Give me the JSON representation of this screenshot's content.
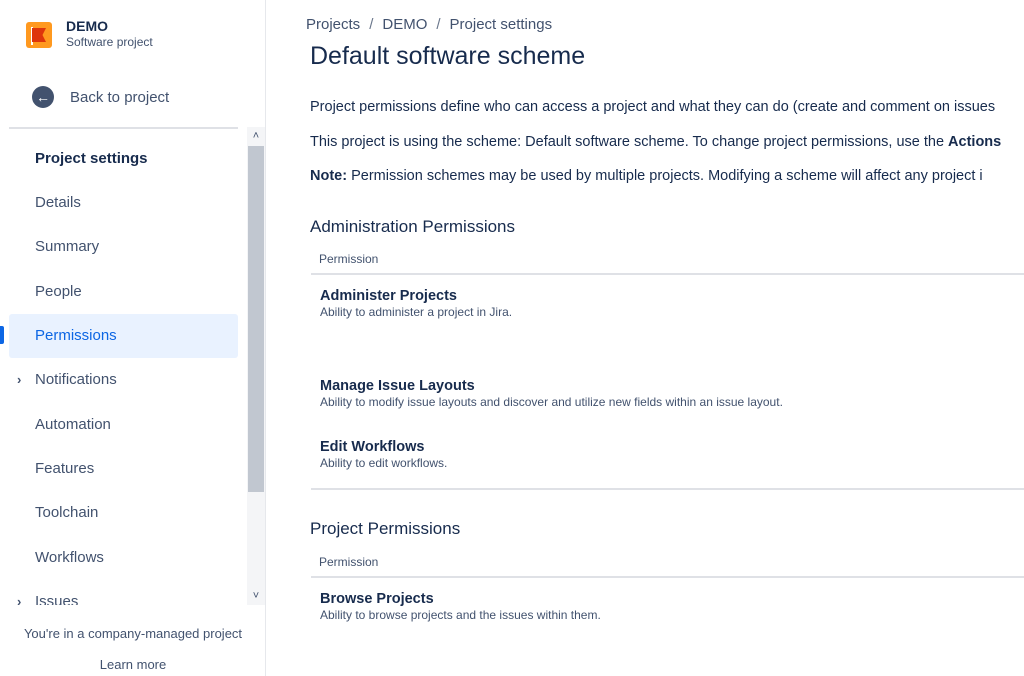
{
  "sidebar": {
    "project_name": "DEMO",
    "project_type": "Software project",
    "back_label": "Back to project",
    "items": [
      {
        "label": "Project settings"
      },
      {
        "label": "Details"
      },
      {
        "label": "Summary"
      },
      {
        "label": "People"
      },
      {
        "label": "Permissions"
      },
      {
        "label": "Notifications"
      },
      {
        "label": "Automation"
      },
      {
        "label": "Features"
      },
      {
        "label": "Toolchain"
      },
      {
        "label": "Workflows"
      },
      {
        "label": "Issues"
      }
    ],
    "footer_text": "You're in a company-managed project",
    "learn_more": "Learn more"
  },
  "breadcrumb": {
    "items": [
      "Projects",
      "DEMO",
      "Project settings"
    ],
    "separator": "/"
  },
  "page_title": "Default software scheme",
  "paragraphs": {
    "p1": "Project permissions define who can access a project and what they can do (create and comment on issues",
    "p2_text": "This project is using the scheme: Default software scheme. To change project permissions, use the ",
    "p2_bold": "Actions",
    "p3_bold": "Note:",
    "p3_text": " Permission schemes may be used by multiple projects. Modifying a scheme will affect any project i"
  },
  "sections": [
    {
      "title": "Administration Permissions",
      "column_header": "Permission",
      "permissions": [
        {
          "name": "Administer Projects",
          "description": "Ability to administer a project in Jira."
        },
        {
          "name": "Manage Issue Layouts",
          "description": "Ability to modify issue layouts and discover and utilize new fields within an issue layout."
        },
        {
          "name": "Edit Workflows",
          "description": "Ability to edit workflows."
        }
      ]
    },
    {
      "title": "Project Permissions",
      "column_header": "Permission",
      "permissions": [
        {
          "name": "Browse Projects",
          "description": "Ability to browse projects and the issues within them."
        }
      ]
    }
  ],
  "colors": {
    "accent": "#0c66e4",
    "active_bg": "#e9f2ff",
    "text": "#172b4d",
    "subtle_text": "#42526e",
    "project_avatar": "#ff991f"
  },
  "icons": {
    "back": "arrow-left-circle-icon",
    "expand": "chevron-right-icon",
    "scroll_up": "chevron-up-icon",
    "scroll_down": "chevron-down-icon"
  }
}
